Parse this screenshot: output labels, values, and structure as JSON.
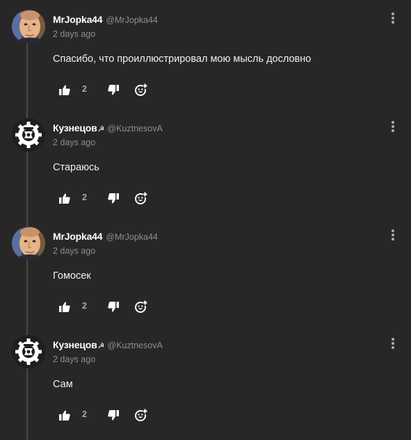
{
  "comments": [
    {
      "username": "MrJopka44",
      "badge": "",
      "handle": "@MrJopka44",
      "time": "2 days ago",
      "text": "Спасибо, что проиллюстрировал мою мысль дословно",
      "likes": "2",
      "avatar": "face-photo"
    },
    {
      "username": "Кузнецов",
      "badge": "☭",
      "handle": "@KuztnesovA",
      "time": "2 days ago",
      "text": "Стараюсь",
      "likes": "2",
      "avatar": "gear-emblem"
    },
    {
      "username": "MrJopka44",
      "badge": "",
      "handle": "@MrJopka44",
      "time": "2 days ago",
      "text": "Гомосек",
      "likes": "2",
      "avatar": "face-photo"
    },
    {
      "username": "Кузнецов",
      "badge": "☭",
      "handle": "@KuztnesovA",
      "time": "2 days ago",
      "text": "Сам",
      "likes": "2",
      "avatar": "gear-emblem"
    }
  ],
  "colors": {
    "background": "#272727",
    "text": "#f0f0f0",
    "muted": "#8e8e8e",
    "thread_line": "#4a4a4a"
  }
}
